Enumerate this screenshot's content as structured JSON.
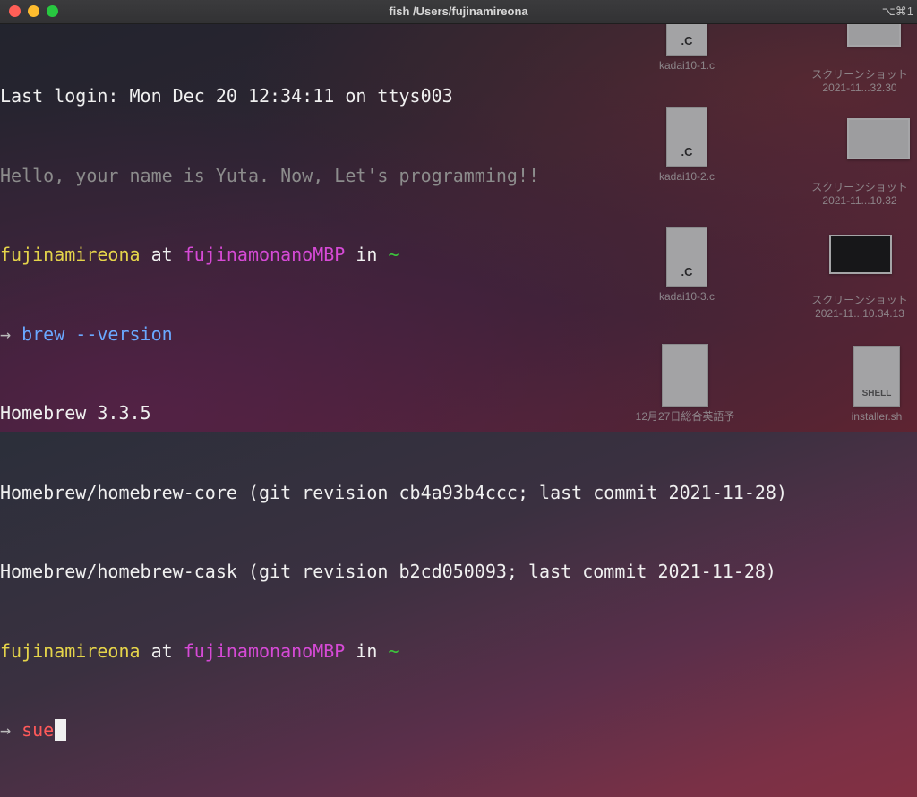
{
  "window": {
    "title": "fish /Users/fujinamireona",
    "shortcut": "⌥⌘1"
  },
  "terminal": {
    "last_login": "Last login: Mon Dec 20 12:34:11 on ttys003",
    "greeting": "Hello, your name is Yuta. Now, Let's programming!!",
    "prompt1": {
      "user": "fujinamireona",
      "at": " at ",
      "host": "fujinamonanoMBP",
      "in": " in ",
      "dir": "~"
    },
    "cmd1": {
      "arrow": "→ ",
      "text": "brew --version"
    },
    "out1": "Homebrew 3.3.5",
    "out2": "Homebrew/homebrew-core (git revision cb4a93b4ccc; last commit 2021-11-28)",
    "out3": "Homebrew/homebrew-cask (git revision b2cd050093; last commit 2021-11-28)",
    "prompt2": {
      "user": "fujinamireona",
      "at": " at ",
      "host": "fujinamonanoMBP",
      "in": " in ",
      "dir": "~"
    },
    "cmd2": {
      "arrow": "→ ",
      "text": "sue"
    }
  },
  "desktop": {
    "icons": [
      {
        "label": "kadai10-1.c",
        "ext": ".C"
      },
      {
        "label": "kadai10-2.c",
        "ext": ".C"
      },
      {
        "label": "kadai10-3.c",
        "ext": ".C"
      },
      {
        "label": "12月27日総合英語予",
        "ext": ""
      },
      {
        "label1": "スクリーンショット",
        "label2": "2021-11...32.30"
      },
      {
        "label1": "スクリーンショット",
        "label2": "2021-11...10.32"
      },
      {
        "label1": "スクリーンショット",
        "label2": "2021-11...10.34.13"
      },
      {
        "label": "installer.sh",
        "ext": "SHELL"
      }
    ]
  }
}
